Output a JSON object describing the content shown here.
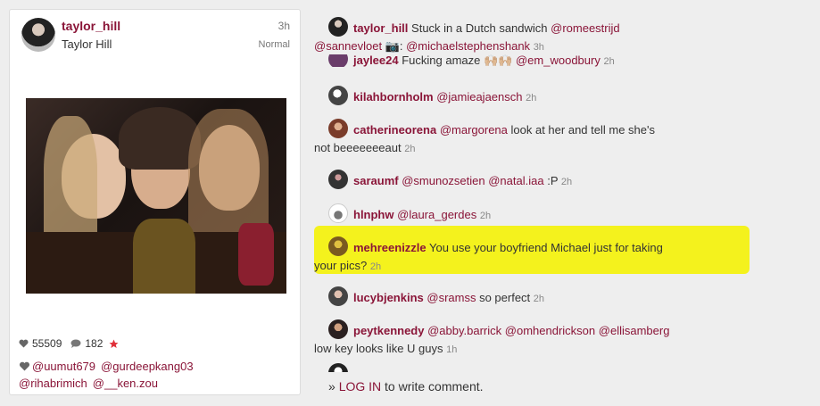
{
  "post": {
    "username": "taylor_hill",
    "full_name": "Taylor Hill",
    "time": "3h",
    "filter": "Normal",
    "likes": "55509",
    "comment_count": "182",
    "likers": [
      "@uumut679",
      "@gurdeepkang03",
      "@rihabrimich",
      "@__ken.zou"
    ]
  },
  "comments": [
    {
      "user": "taylor_hill",
      "parts": [
        "Stuck in a Dutch sandwich ",
        "@romeestrijd",
        "",
        "@sannevloet",
        " 📷: ",
        "@michaelstephenshank"
      ],
      "ago": "3h"
    },
    {
      "user": "jaylee24",
      "text": "Fucking amaze 🙌🏼🙌🏼 ",
      "mention": "@em_woodbury",
      "ago": "2h"
    },
    {
      "user": "kilahbornholm",
      "mention": "@jamieajaensch",
      "ago": "2h"
    },
    {
      "user": "catherineorena",
      "mention": "@margorena",
      "text": " look at her and tell me she's",
      "text2": "not beeeeeeeaut",
      "ago": "2h"
    },
    {
      "user": "saraumf",
      "mention": "@smunozsetien",
      "mention2": "@natal.iaa",
      "text": " :P",
      "ago": "2h"
    },
    {
      "user": "hlnphw",
      "mention": "@laura_gerdes",
      "ago": "2h"
    },
    {
      "user": "mehreenizzle",
      "text": " You use your boyfriend Michael just for taking",
      "text2": "your pics?",
      "ago": "2h"
    },
    {
      "user": "lucybjenkins",
      "mention": "@sramss",
      "text": " so perfect",
      "ago": "2h"
    },
    {
      "user": "peytkennedy",
      "mention": "@abby.barrick",
      "mention2": "@omhendrickson",
      "mention3": "@ellisamberg",
      "text2": "low key looks like U guys",
      "ago": "1h"
    }
  ],
  "footer": {
    "prefix": "» ",
    "login": "LOG IN",
    "suffix": " to write comment."
  },
  "colors": {
    "accent": "#8a1538",
    "highlight": "#f4f21d"
  }
}
